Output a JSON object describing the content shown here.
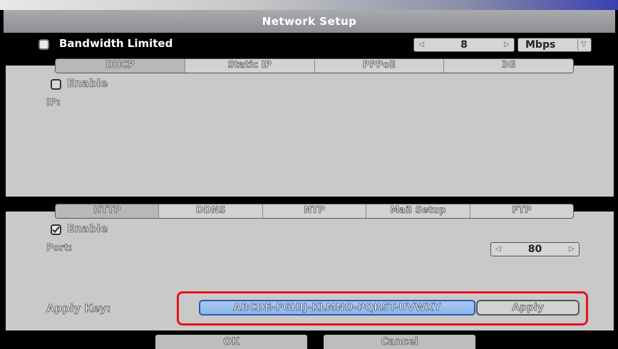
{
  "window": {
    "title": "Network Setup"
  },
  "bandwidth": {
    "label": "Bandwidth Limited",
    "value": "8",
    "unit": "Mbps",
    "checked": false
  },
  "connection_tabs": [
    "DHCP",
    "Static IP",
    "PPPoE",
    "3G"
  ],
  "connection_panel": {
    "enable_label": "Enable",
    "enabled": false,
    "ip_label": "IP:"
  },
  "service_tabs": [
    "HTTP",
    "DDNS",
    "NTP",
    "Mail Setup",
    "FTP"
  ],
  "service_panel": {
    "enable_label": "Enable",
    "enabled": true,
    "port_label": "Port:",
    "port_value": "80",
    "apply_key_label": "Apply Key:",
    "apply_key_value": "ABCDE-FGHIJ-KLMNO-PQRST-UVWXY",
    "apply_button": "Apply"
  },
  "footer": {
    "ok": "OK",
    "cancel": "Cancel"
  },
  "colors": {
    "highlight": "#e8121a",
    "key_field": "#a9c9f3",
    "panel": "#c9c9c9"
  }
}
